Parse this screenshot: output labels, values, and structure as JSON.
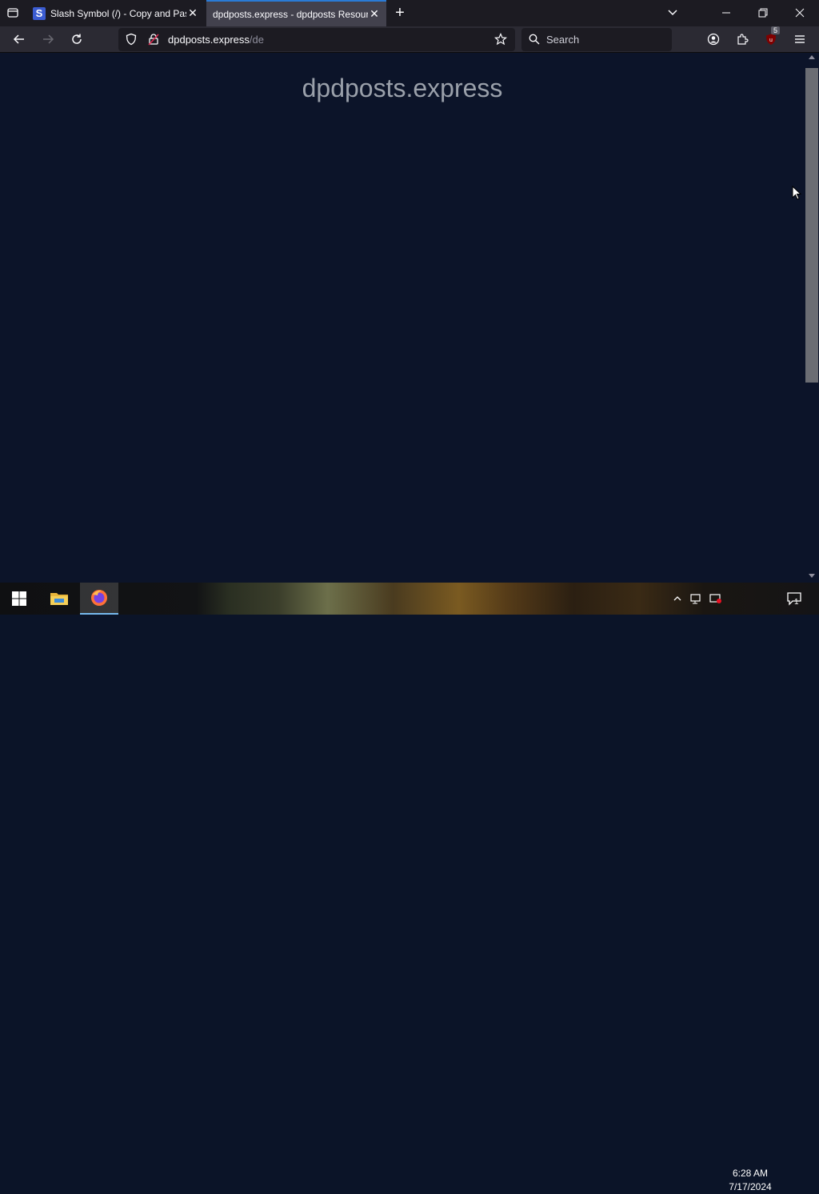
{
  "browser": {
    "tabs": [
      {
        "title": "Slash Symbol (/) - Copy and Pas",
        "favicon_letter": "S",
        "active": false
      },
      {
        "title": "dpdposts.express - dpdposts Resour",
        "active": true
      }
    ],
    "url_host": "dpdposts.express",
    "url_path": "/de",
    "search_placeholder": "Search",
    "extension_badge": "5"
  },
  "page": {
    "heading": "dpdposts.express",
    "scroll_fraction_visible": 0.6
  },
  "taskbar": {
    "time": "6:28 AM",
    "date": "7/17/2024",
    "notification_count": "1"
  },
  "colors": {
    "page_bg": "#0c1429",
    "heading": "#9aa0aa",
    "active_tab_accent": "#2a7bd6"
  }
}
